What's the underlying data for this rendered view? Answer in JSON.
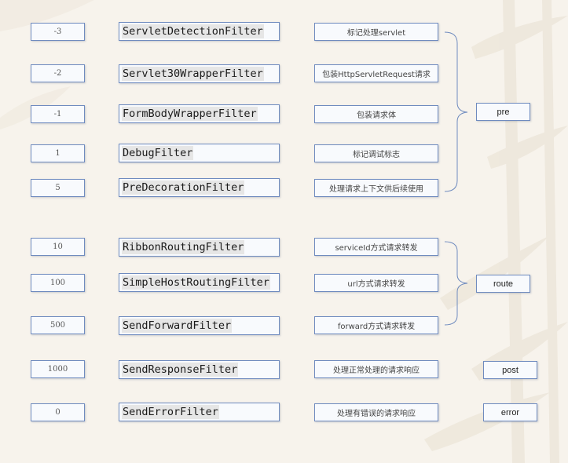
{
  "colors": {
    "border": "#6f8bbf",
    "background": "#f7f3ec",
    "cell_fill": "#f8fafd"
  },
  "rows": [
    {
      "order": "-3",
      "filter": "ServletDetectionFilter",
      "desc": "标记处理servlet"
    },
    {
      "order": "-2",
      "filter": "Servlet30WrapperFilter",
      "desc": "包装HttpServletRequest请求"
    },
    {
      "order": "-1",
      "filter": "FormBodyWrapperFilter",
      "desc": "包装请求体"
    },
    {
      "order": "1",
      "filter": "DebugFilter",
      "desc": "标记调试标志"
    },
    {
      "order": "5",
      "filter": "PreDecorationFilter",
      "desc": "处理请求上下文供后续使用"
    },
    {
      "order": "10",
      "filter": "RibbonRoutingFilter",
      "desc": "serviceId方式请求转发"
    },
    {
      "order": "100",
      "filter": "SimpleHostRoutingFilter",
      "desc": "url方式请求转发"
    },
    {
      "order": "500",
      "filter": "SendForwardFilter",
      "desc": "forward方式请求转发"
    },
    {
      "order": "1000",
      "filter": "SendResponseFilter",
      "desc": "处理正常处理的请求响应"
    },
    {
      "order": "0",
      "filter": "SendErrorFilter",
      "desc": "处理有错误的请求响应"
    }
  ],
  "types": {
    "pre": "pre",
    "route": "route",
    "post": "post",
    "error": "error"
  }
}
